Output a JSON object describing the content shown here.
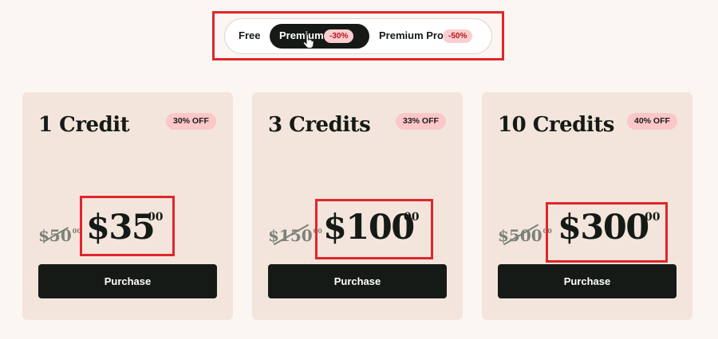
{
  "plans": {
    "options": [
      {
        "label": "Free",
        "badge": ""
      },
      {
        "label": "Premium",
        "badge": "-30%",
        "active": true
      },
      {
        "label": "Premium Pro",
        "badge": "-50%"
      }
    ]
  },
  "cards": [
    {
      "title": "1 Credit",
      "discount": "30% OFF",
      "old_price": "$50",
      "old_cents": "00",
      "price": "$35",
      "cents": "00",
      "button": "Purchase"
    },
    {
      "title": "3 Credits",
      "discount": "33% OFF",
      "old_price": "$150",
      "old_cents": "00",
      "price": "$100",
      "cents": "00",
      "button": "Purchase"
    },
    {
      "title": "10 Credits",
      "discount": "40% OFF",
      "old_price": "$500",
      "old_cents": "00",
      "price": "$300",
      "cents": "00",
      "button": "Purchase"
    }
  ],
  "colors": {
    "background": "#fcf6f2",
    "card": "#f3e5dc",
    "dark": "#161a16",
    "badge": "#fbc7c7",
    "highlight": "#e0262b"
  },
  "icons": {
    "cursor": "hand-pointer-icon"
  }
}
